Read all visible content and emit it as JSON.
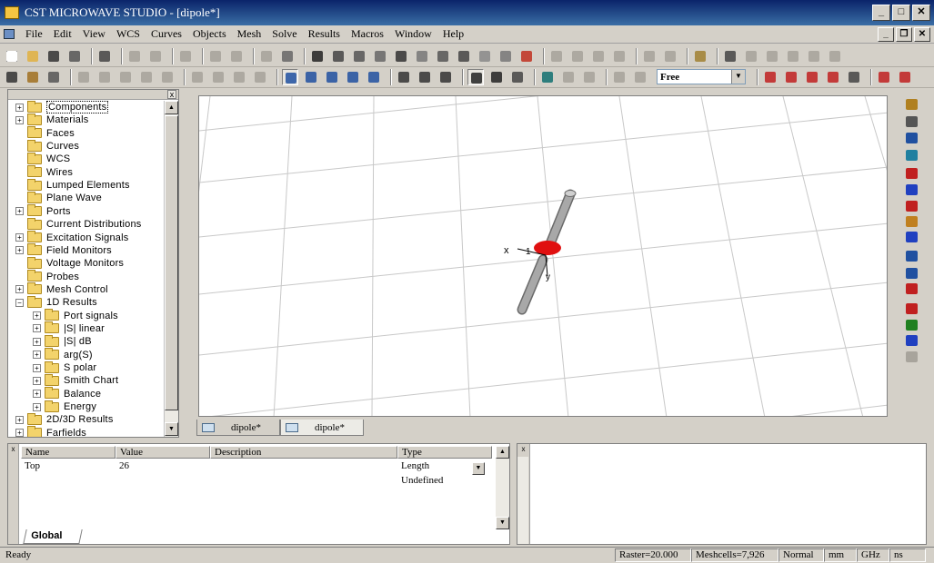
{
  "window": {
    "title": "CST MICROWAVE STUDIO - [dipole*]",
    "min_label": "_",
    "max_label": "□",
    "close_label": "✕"
  },
  "menu": [
    "File",
    "Edit",
    "View",
    "WCS",
    "Curves",
    "Objects",
    "Mesh",
    "Solve",
    "Results",
    "Macros",
    "Window",
    "Help"
  ],
  "mdi": {
    "min_label": "_",
    "restore_label": "❐",
    "close_label": "✕"
  },
  "toolbar2": {
    "mode_select_value": "Free",
    "dropdown_arrow": "▼"
  },
  "tree": {
    "items": [
      {
        "label": "Components",
        "expander": "+",
        "selected": true
      },
      {
        "label": "Materials",
        "expander": "+"
      },
      {
        "label": "Faces",
        "expander": ""
      },
      {
        "label": "Curves",
        "expander": ""
      },
      {
        "label": "WCS",
        "expander": ""
      },
      {
        "label": "Wires",
        "expander": ""
      },
      {
        "label": "Lumped Elements",
        "expander": ""
      },
      {
        "label": "Plane Wave",
        "expander": ""
      },
      {
        "label": "Ports",
        "expander": "+"
      },
      {
        "label": "Current Distributions",
        "expander": ""
      },
      {
        "label": "Excitation Signals",
        "expander": "+"
      },
      {
        "label": "Field Monitors",
        "expander": "+"
      },
      {
        "label": "Voltage Monitors",
        "expander": ""
      },
      {
        "label": "Probes",
        "expander": ""
      },
      {
        "label": "Mesh Control",
        "expander": "+"
      },
      {
        "label": "1D Results",
        "expander": "−"
      },
      {
        "label": "Port signals",
        "expander": "+",
        "child": true
      },
      {
        "label": "|S| linear",
        "expander": "+",
        "child": true
      },
      {
        "label": "|S| dB",
        "expander": "+",
        "child": true
      },
      {
        "label": "arg(S)",
        "expander": "+",
        "child": true
      },
      {
        "label": "S polar",
        "expander": "+",
        "child": true
      },
      {
        "label": "Smith Chart",
        "expander": "+",
        "child": true
      },
      {
        "label": "Balance",
        "expander": "+",
        "child": true
      },
      {
        "label": "Energy",
        "expander": "+",
        "child": true
      },
      {
        "label": "2D/3D Results",
        "expander": "+"
      },
      {
        "label": "Farfields",
        "expander": "+"
      }
    ],
    "scroll_up": "▲",
    "scroll_down": "▼",
    "close_label": "x"
  },
  "viewport": {
    "axis_x_label": "x",
    "axis_y_label": "y",
    "port_label": "1"
  },
  "doc_tabs": [
    {
      "label": "dipole*",
      "active": false
    },
    {
      "label": "dipole*",
      "active": true
    }
  ],
  "parameters": {
    "columns": [
      "Name",
      "Value",
      "Description",
      "Type"
    ],
    "rows": [
      {
        "name": "Top",
        "value": "26",
        "description": "",
        "type": "Length"
      },
      {
        "name": "",
        "value": "",
        "description": "",
        "type": "Undefined"
      }
    ],
    "dropdown_arrow": "▼",
    "scroll_up": "▲",
    "scroll_down": "▼",
    "close_label": "x",
    "tab_label": "Global"
  },
  "messages": {
    "close_label": "x"
  },
  "status": {
    "ready": "Ready",
    "raster": "Raster=20.000",
    "meshcells": "Meshcells=7,926",
    "normal": "Normal",
    "unit_length": "mm",
    "unit_freq": "GHz",
    "unit_time": "ns"
  },
  "colors": {
    "title_bar": "#0a246a",
    "chrome": "#d4d0c8",
    "folder": "#f3d36b",
    "dipole": "#9a9a9a",
    "port": "#e01010"
  }
}
